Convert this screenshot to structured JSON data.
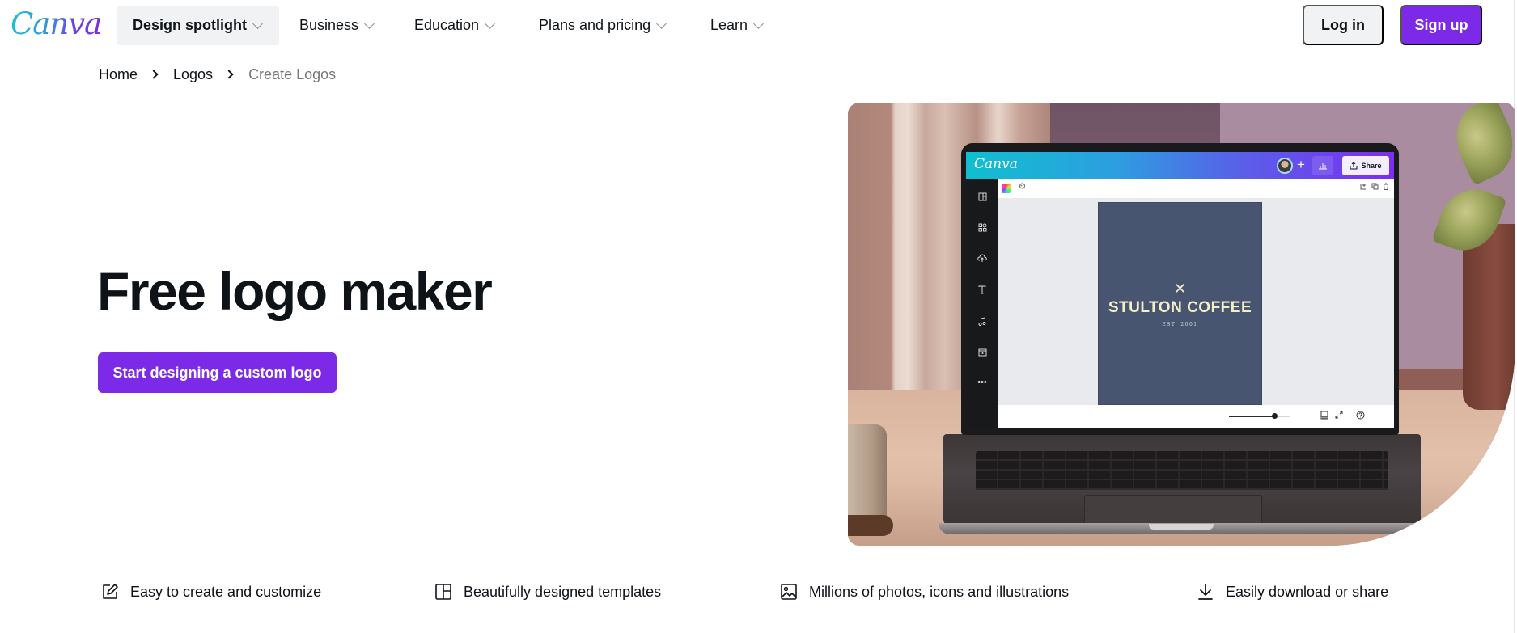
{
  "nav": {
    "logo": "Canva",
    "items": [
      {
        "label": "Design spotlight",
        "active": true
      },
      {
        "label": "Business",
        "active": false
      },
      {
        "label": "Education",
        "active": false
      },
      {
        "label": "Plans and pricing",
        "active": false
      },
      {
        "label": "Learn",
        "active": false
      }
    ],
    "login_label": "Log in",
    "signup_label": "Sign up"
  },
  "breadcrumb": {
    "items": [
      "Home",
      "Logos",
      "Create Logos"
    ]
  },
  "hero": {
    "title": "Free logo maker",
    "cta_label": "Start designing a custom logo",
    "mockup": {
      "app_logo": "Canva",
      "share_label": "Share",
      "plus": "+",
      "design": {
        "symbol": "✕",
        "title": "STULTON COFFEE",
        "subtitle": "EST. 2001"
      },
      "sidebar_icons": [
        "templates-icon",
        "elements-icon",
        "uploads-icon",
        "text-icon",
        "audio-icon",
        "videos-icon",
        "more-icon"
      ],
      "zoom_level": 0.75
    }
  },
  "features": [
    {
      "icon": "pencil-edit-icon",
      "label": "Easy to create and customize"
    },
    {
      "icon": "layout-template-icon",
      "label": "Beautifully designed templates"
    },
    {
      "icon": "image-icon",
      "label": "Millions of photos, icons and illustrations"
    },
    {
      "icon": "download-icon",
      "label": "Easily download or share"
    }
  ],
  "colors": {
    "brand_purple": "#7d2ae8",
    "nav_active_bg": "#f1f2f4",
    "text": "#0e1318",
    "muted_text": "#76787c",
    "design_bg": "#475570",
    "design_text": "#f5efc6"
  }
}
